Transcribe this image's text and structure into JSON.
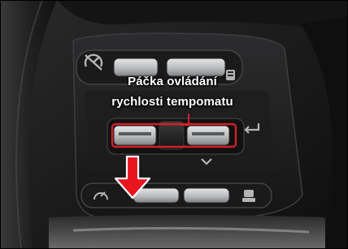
{
  "photo": {
    "subject": "steering wheel spoke with cruise control switches",
    "colors": {
      "background": "#1c1c1c",
      "panel": "#232324",
      "button_silver": "#c9cacb",
      "icon_gray": "#b4b4b4",
      "highlight_red": "#d11f2a",
      "arrow_fill": "#e8141e",
      "arrow_outline": "#ffffff",
      "label_text": "#ffffff"
    },
    "icons": [
      "cruise-control-icon",
      "distance-setting-icon",
      "cancel-icon",
      "return-arrow-icon",
      "down-chevron-icon",
      "cruise-control-icon",
      "vehicle-distance-icon"
    ]
  },
  "callout": {
    "line1": "Páčka ovládání",
    "line2": "rychlosti tempomatu"
  }
}
